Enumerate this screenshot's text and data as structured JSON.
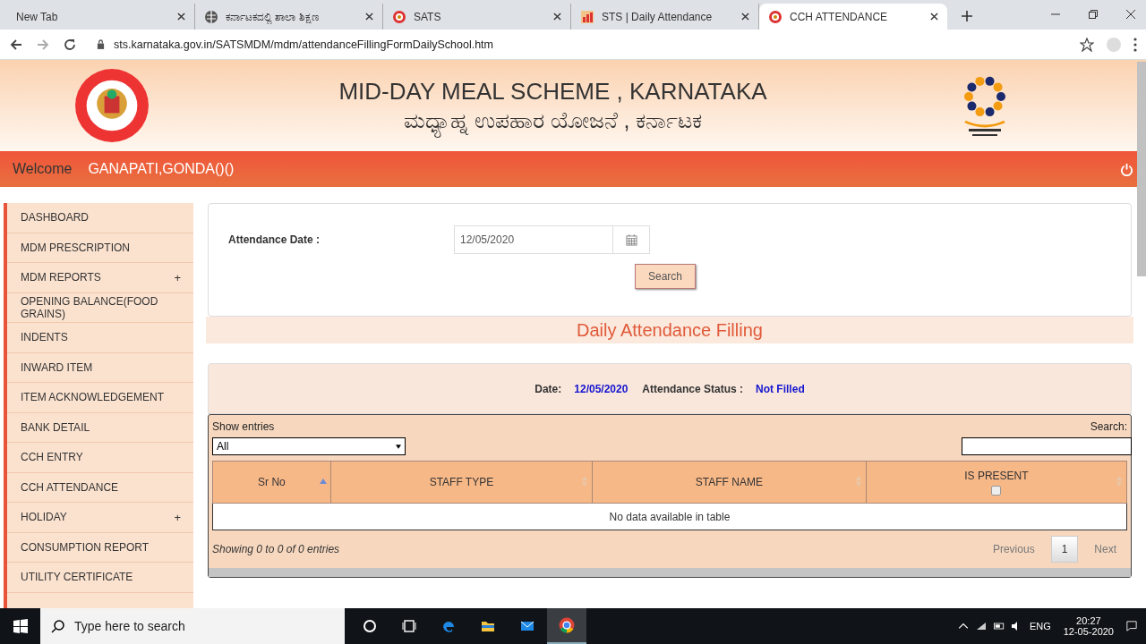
{
  "browser": {
    "tabs": [
      {
        "title": "New Tab",
        "kind": "plain",
        "selected": false
      },
      {
        "title": "ಕರ್ನಾಟಕದಲ್ಲಿ ಶಾಲಾ ಶಿಕ್ಷಣ",
        "kind": "web",
        "selected": false
      },
      {
        "title": "SATS",
        "kind": "portal",
        "selected": false
      },
      {
        "title": "STS | Daily Attendance",
        "kind": "report",
        "selected": false
      },
      {
        "title": "CCH ATTENDANCE",
        "kind": "portal",
        "selected": true
      }
    ],
    "url": "sts.karnataka.gov.in/SATSMDM/mdm/attendanceFillingFormDailySchool.htm"
  },
  "header": {
    "title": "MID-DAY MEAL SCHEME , KARNATAKA",
    "subtitle": "ಮಧ್ಯಾಹ್ನ ಉಪಹಾರ ಯೋಜನೆ , ಕರ್ನಾಟಕ"
  },
  "welcome": {
    "label": "Welcome",
    "user": "GANAPATI,GONDA()()"
  },
  "sidebar": {
    "items": [
      {
        "label": "DASHBOARD"
      },
      {
        "label": "MDM PRESCRIPTION"
      },
      {
        "label": "MDM REPORTS",
        "toggle": "+"
      },
      {
        "label": "OPENING BALANCE(FOOD GRAINS)"
      },
      {
        "label": "INDENTS"
      },
      {
        "label": "INWARD ITEM"
      },
      {
        "label": "ITEM ACKNOWLEDGEMENT"
      },
      {
        "label": "BANK DETAIL"
      },
      {
        "label": "CCH ENTRY"
      },
      {
        "label": "CCH ATTENDANCE"
      },
      {
        "label": "HOLIDAY",
        "toggle": "+"
      },
      {
        "label": "CONSUMPTION REPORT"
      },
      {
        "label": "UTILITY CERTIFICATE"
      }
    ]
  },
  "form": {
    "date_label": "Attendance Date :",
    "date_value": "12/05/2020",
    "search_button": "Search"
  },
  "section_title": "Daily Attendance Filling",
  "status": {
    "date_label": "Date:",
    "date_value": "12/05/2020",
    "status_label": "Attendance Status :",
    "status_value": "Not Filled"
  },
  "table": {
    "show_entries_label": "Show entries",
    "entries_value": "All",
    "search_label": "Search:",
    "columns": [
      {
        "label": "Sr No",
        "sorted": true
      },
      {
        "label": "STAFF TYPE",
        "sorted": false
      },
      {
        "label": "STAFF NAME",
        "sorted": false
      },
      {
        "label": "IS PRESENT",
        "sorted": false,
        "checked": false
      }
    ],
    "empty_message": "No data available in table",
    "info": "Showing 0 to 0 of 0 entries",
    "pagination": {
      "previous": "Previous",
      "pages": [
        {
          "label": "1",
          "selected": true
        }
      ],
      "next": "Next"
    }
  },
  "taskbar": {
    "search_placeholder": "Type here to search",
    "language": "ENG",
    "time": "20:27",
    "date": "12-05-2020"
  }
}
